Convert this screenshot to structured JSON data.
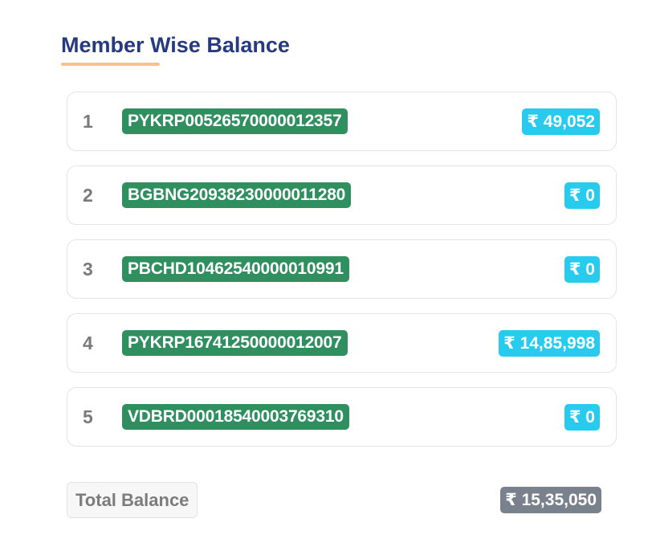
{
  "header": {
    "title": "Member Wise Balance"
  },
  "colors": {
    "title": "#263a80",
    "underline": "#f5c48b",
    "account_badge": "#2f8f5f",
    "amount_badge": "#26cbee",
    "total_badge": "#79818c"
  },
  "members": [
    {
      "index": "1",
      "account": "PYKRP00526570000012357",
      "balance": "₹ 49,052"
    },
    {
      "index": "2",
      "account": "BGBNG20938230000011280",
      "balance": "₹ 0"
    },
    {
      "index": "3",
      "account": "PBCHD10462540000010991",
      "balance": "₹ 0"
    },
    {
      "index": "4",
      "account": "PYKRP16741250000012007",
      "balance": "₹ 14,85,998"
    },
    {
      "index": "5",
      "account": "VDBRD00018540003769310",
      "balance": "₹ 0"
    }
  ],
  "total": {
    "label": "Total Balance",
    "value": "₹ 15,35,050"
  }
}
